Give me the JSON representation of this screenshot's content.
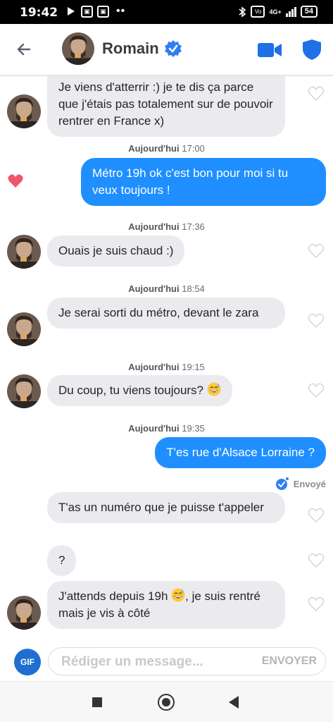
{
  "status_bar": {
    "time": "19:42",
    "network": "4G+",
    "battery": "54"
  },
  "header": {
    "contact_name": "Romain"
  },
  "messages": [
    {
      "sender": "them",
      "text": "Je viens d'atterrir :) je te dis ça parce que j'étais pas totalement sur de pouvoir rentrer en France x)"
    },
    {
      "timestamp_day": "Aujourd'hui",
      "timestamp_time": "17:00"
    },
    {
      "sender": "me",
      "text": "Métro 19h ok c'est bon pour moi si tu veux toujours !",
      "liked": true
    },
    {
      "timestamp_day": "Aujourd'hui",
      "timestamp_time": "17:36"
    },
    {
      "sender": "them",
      "text": "Ouais je suis chaud :)"
    },
    {
      "timestamp_day": "Aujourd'hui",
      "timestamp_time": "18:54"
    },
    {
      "sender": "them",
      "text": "Je serai sorti du métro, devant le zara"
    },
    {
      "timestamp_day": "Aujourd'hui",
      "timestamp_time": "19:15"
    },
    {
      "sender": "them",
      "text": "Du coup, tu viens toujours?"
    },
    {
      "timestamp_day": "Aujourd'hui",
      "timestamp_time": "19:35"
    },
    {
      "sender": "me",
      "text": "T'es rue d'Alsace Lorraine ?",
      "status": "Envoyé"
    },
    {
      "sender": "them",
      "text": "T'as un numéro que je puisse t'appeler"
    },
    {
      "sender": "them",
      "text": "?"
    },
    {
      "sender": "them",
      "text_before_emoji": "J'attends depuis 19h",
      "text_after_emoji": ", je suis rentré mais je vis à côté"
    }
  ],
  "composer": {
    "gif_label": "GIF",
    "placeholder": "Rédiger un message...",
    "send_label": "ENVOYER"
  },
  "icons": {
    "back": "arrow-left-icon",
    "verified": "verified-badge-icon",
    "video": "video-camera-icon",
    "shield": "shield-icon",
    "heart": "heart-icon",
    "emoji": "sweat-smile-emoji"
  },
  "colors": {
    "accent_blue": "#1f8fff",
    "incoming_bubble": "#ebebef",
    "liked_heart": "#f0566b"
  }
}
